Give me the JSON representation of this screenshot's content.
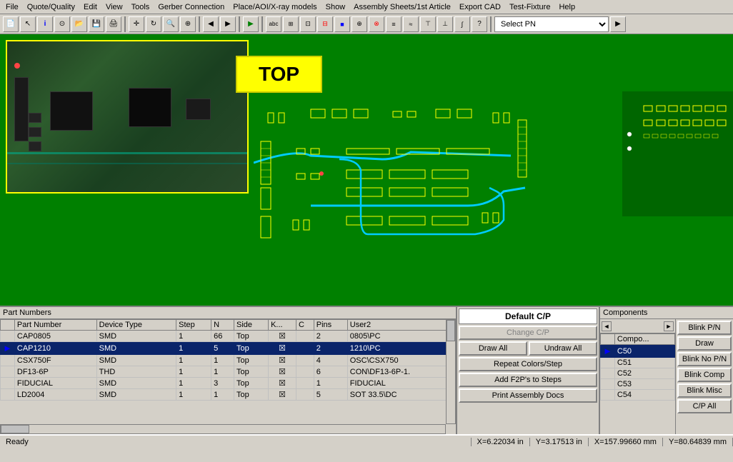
{
  "menubar": {
    "items": [
      "File",
      "Quote/Quality",
      "Edit",
      "View",
      "Tools",
      "Gerber Connection",
      "Place/AOI/X-ray models",
      "Show",
      "Assembly Sheets/1st Article",
      "Export CAD",
      "Test-Fixture",
      "Help"
    ]
  },
  "toolbar": {
    "pn_select_placeholder": "Select PN",
    "pn_select_value": "Select PN"
  },
  "main": {
    "top_label": "TOP"
  },
  "bottom": {
    "part_numbers_title": "Part Numbers",
    "components_title": "Components",
    "cp_display": "Default C/P",
    "table": {
      "headers": [
        "",
        "Part Number",
        "Device Type",
        "Step",
        "N",
        "Side",
        "K...",
        "C",
        "Pins",
        "User2"
      ],
      "rows": [
        {
          "arrow": "",
          "pn": "CAP0805",
          "device": "SMD",
          "step": "1",
          "n": "66",
          "side": "Top",
          "k": "☒",
          "c": "",
          "pins": "2",
          "user2": "0805\\PC"
        },
        {
          "arrow": "►",
          "pn": "CAP1210",
          "device": "SMD",
          "step": "1",
          "n": "5",
          "side": "Top",
          "k": "☒",
          "c": "",
          "pins": "2",
          "user2": "1210\\PC"
        },
        {
          "arrow": "",
          "pn": "CSX750F",
          "device": "SMD",
          "step": "1",
          "n": "1",
          "side": "Top",
          "k": "☒",
          "c": "",
          "pins": "4",
          "user2": "OSC\\CSX750"
        },
        {
          "arrow": "",
          "pn": "DF13-6P",
          "device": "THD",
          "step": "1",
          "n": "1",
          "side": "Top",
          "k": "☒",
          "c": "",
          "pins": "6",
          "user2": "CON\\DF13-6P-1."
        },
        {
          "arrow": "",
          "pn": "FIDUCIAL",
          "device": "SMD",
          "step": "1",
          "n": "3",
          "side": "Top",
          "k": "☒",
          "c": "",
          "pins": "1",
          "user2": "FIDUCIAL"
        },
        {
          "arrow": "",
          "pn": "LD2004",
          "device": "SMD",
          "step": "1",
          "n": "1",
          "side": "Top",
          "k": "☒",
          "c": "",
          "pins": "5",
          "user2": "SOT 33.5\\DC"
        }
      ]
    },
    "buttons": {
      "change_cp": "Change C/P",
      "draw_all": "Draw All",
      "undraw_all": "Undraw All",
      "repeat_colors": "Repeat Colors/Step",
      "add_f2p": "Add F2P's to Steps",
      "print_docs": "Print Assembly Docs"
    },
    "comp_buttons": {
      "blink_pn": "Blink P/N",
      "draw": "Draw",
      "blink_no_pn": "Blink No P/N",
      "blink_comp": "Blink Comp",
      "blink_misc": "Blink Misc",
      "cp_all": "C/P All"
    },
    "comp_list": {
      "headers": [
        "Compo..."
      ],
      "rows": [
        "C50",
        "C51",
        "C52",
        "C53",
        "C54"
      ]
    },
    "blue_arrow": "►"
  },
  "statusbar": {
    "ready": "Ready",
    "x_in": "X=6.22034 in",
    "y_in": "Y=3.17513 in",
    "x_mm": "X=157.99660 mm",
    "y_mm": "Y=80.64839 mm"
  }
}
